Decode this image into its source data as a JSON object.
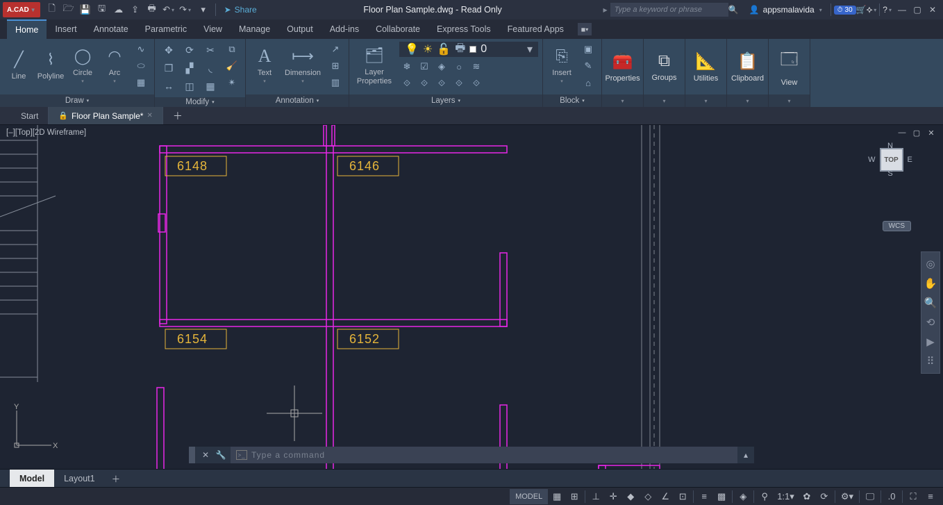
{
  "titlebar": {
    "app_logo_text": "A.CAD",
    "share_label": "Share",
    "document_title": "Floor Plan Sample.dwg - Read Only",
    "search_placeholder": "Type a keyword or phrase",
    "username": "appsmalavida",
    "trial_days": "30"
  },
  "ribbon_tabs": [
    "Home",
    "Insert",
    "Annotate",
    "Parametric",
    "View",
    "Manage",
    "Output",
    "Add-ins",
    "Collaborate",
    "Express Tools",
    "Featured Apps"
  ],
  "ribbon": {
    "draw": {
      "label": "Draw",
      "line": "Line",
      "polyline": "Polyline",
      "circle": "Circle",
      "arc": "Arc"
    },
    "modify": {
      "label": "Modify"
    },
    "annotation": {
      "label": "Annotation",
      "text": "Text",
      "dimension": "Dimension"
    },
    "layers": {
      "label": "Layers",
      "properties": "Layer\nProperties",
      "current_layer": "0"
    },
    "block": {
      "label": "Block",
      "insert": "Insert"
    },
    "properties": {
      "label": "Properties"
    },
    "groups": {
      "label": "Groups"
    },
    "utilities": {
      "label": "Utilities"
    },
    "clipboard": {
      "label": "Clipboard"
    },
    "view": {
      "label": "View"
    }
  },
  "file_tabs": {
    "start": "Start",
    "active": "Floor Plan Sample*"
  },
  "canvas": {
    "viewport_label": "[–][Top][2D Wireframe]",
    "dims": {
      "d1": "6148",
      "d2": "6146",
      "d3": "6154",
      "d4": "6152"
    },
    "viewcube": {
      "n": "N",
      "s": "S",
      "e": "E",
      "w": "W",
      "face": "TOP"
    },
    "wcs": "WCS",
    "axes": {
      "x": "X",
      "y": "Y"
    },
    "cmd_placeholder": "Type a command"
  },
  "layout_tabs": {
    "model": "Model",
    "layout1": "Layout1"
  },
  "statusbar": {
    "model_btn": "MODEL",
    "scale": "1:1",
    "decimal_icon": ".0"
  }
}
